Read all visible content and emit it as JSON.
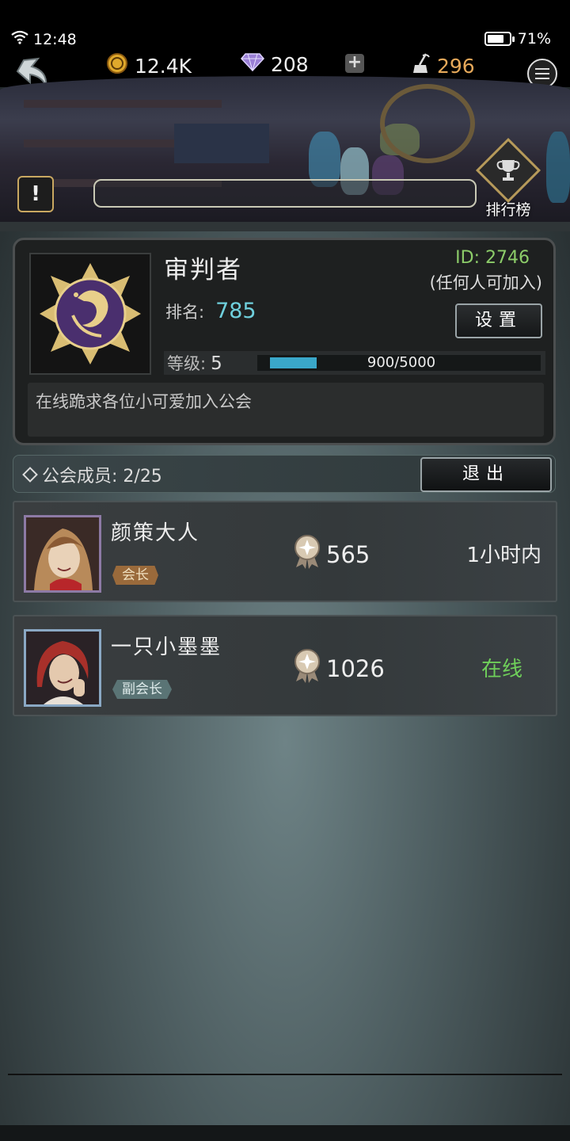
{
  "status_bar": {
    "time": "12:48",
    "battery": "71%"
  },
  "resources": {
    "coins": "12.4K",
    "gems": "208",
    "ink": "296"
  },
  "banner": {
    "search_text": "",
    "leaderboard_label": "排行榜"
  },
  "guild": {
    "name": "审判者",
    "id": "ID: 2746",
    "join_policy": "(任何人可加入)",
    "rank_label": "排名:",
    "rank_value": "785",
    "settings_label": "设置",
    "level_label": "等级:",
    "level_value": "5",
    "xp_text": "900/5000",
    "xp_progress": 0.18,
    "motto": "在线跪求各位小可爱加入公会"
  },
  "members_bar": {
    "label": "公会成员: 2/25",
    "exit_label": "退出"
  },
  "members": [
    {
      "name": "颜策大人",
      "role": "会长",
      "score": "565",
      "status": "1小时内"
    },
    {
      "name": "一只小墨墨",
      "role": "副会长",
      "score": "1026",
      "status": "在线"
    }
  ],
  "colors": {
    "accent_cyan": "#6fd0dd",
    "online_green": "#6fcf5a",
    "gold": "#c9a861"
  }
}
